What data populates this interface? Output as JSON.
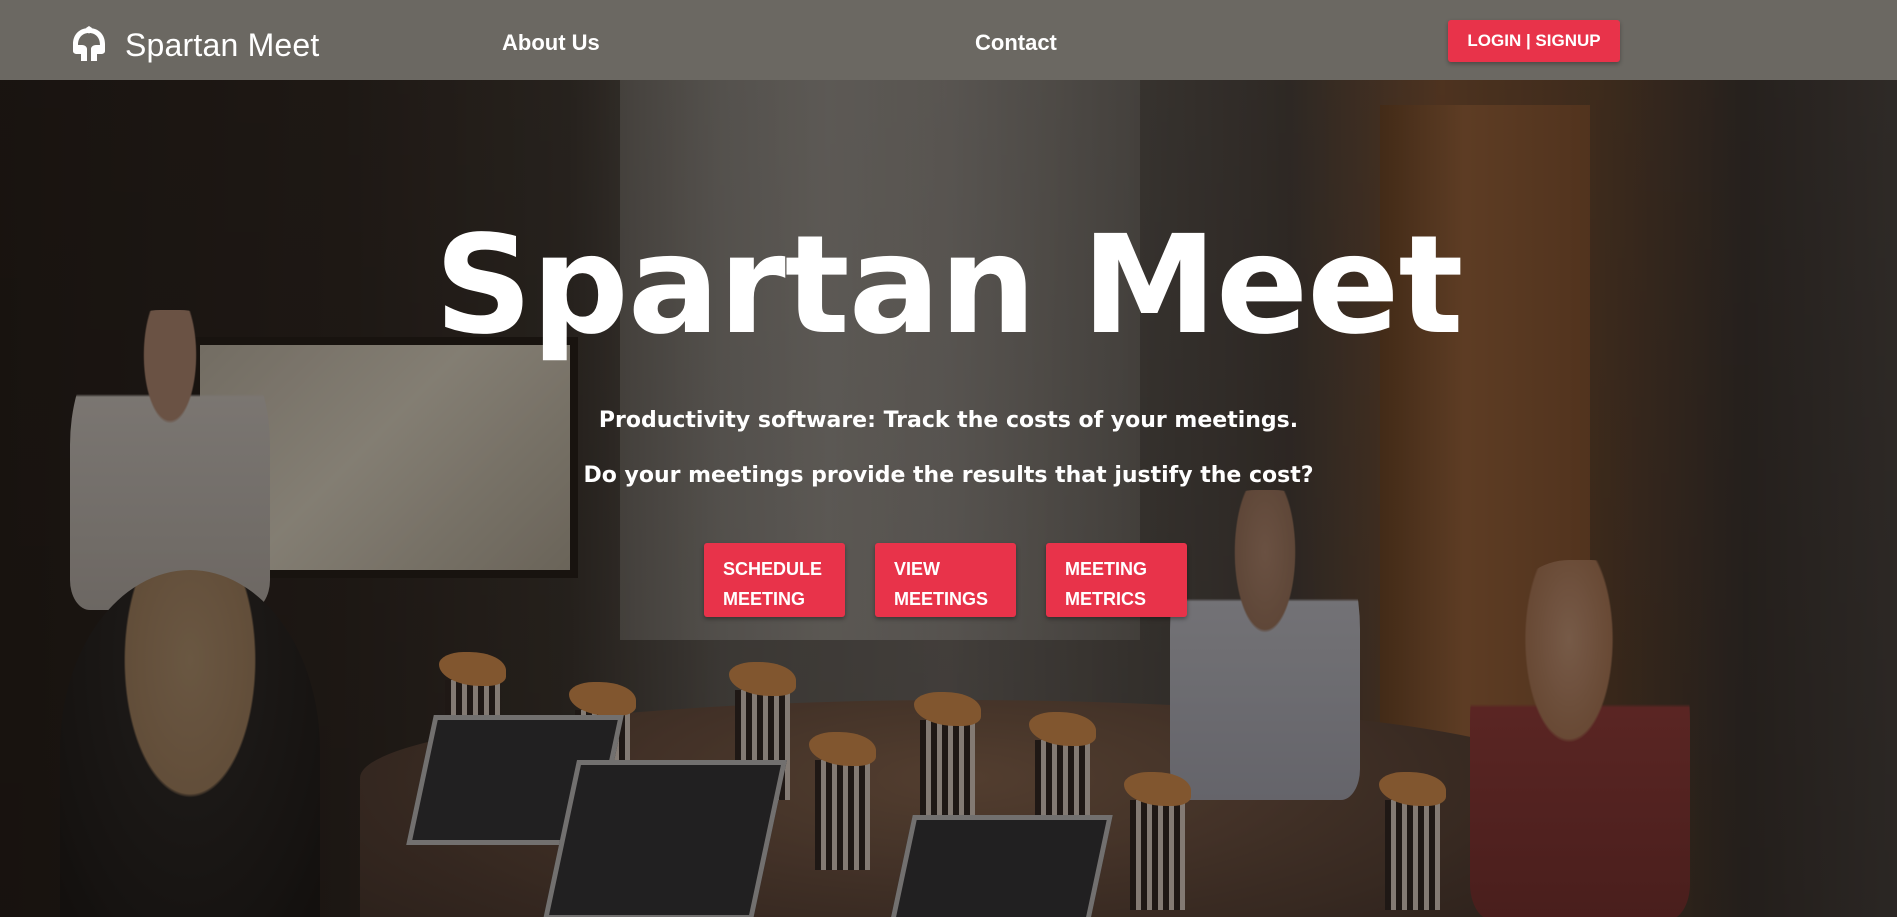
{
  "navbar": {
    "brand_name": "Spartan Meet",
    "links": [
      {
        "label": "About Us"
      },
      {
        "label": "Contact"
      }
    ],
    "login_label": "LOGIN | SIGNUP",
    "logo_icon": "spartan-helmet-icon"
  },
  "hero": {
    "title": "Spartan Meet",
    "tagline_1": "Productivity software: Track the costs of your meetings.",
    "tagline_2": "Do your meetings provide the results that justify the cost?",
    "actions": [
      {
        "label": "SCHEDULE\nMEETING"
      },
      {
        "label": "VIEW\nMEETINGS"
      },
      {
        "label": "MEETING\nMETRICS"
      }
    ],
    "background": "conference-room-photo"
  },
  "colors": {
    "accent": "#e8334a",
    "navbar": "#6b6862",
    "text": "#ffffff"
  }
}
